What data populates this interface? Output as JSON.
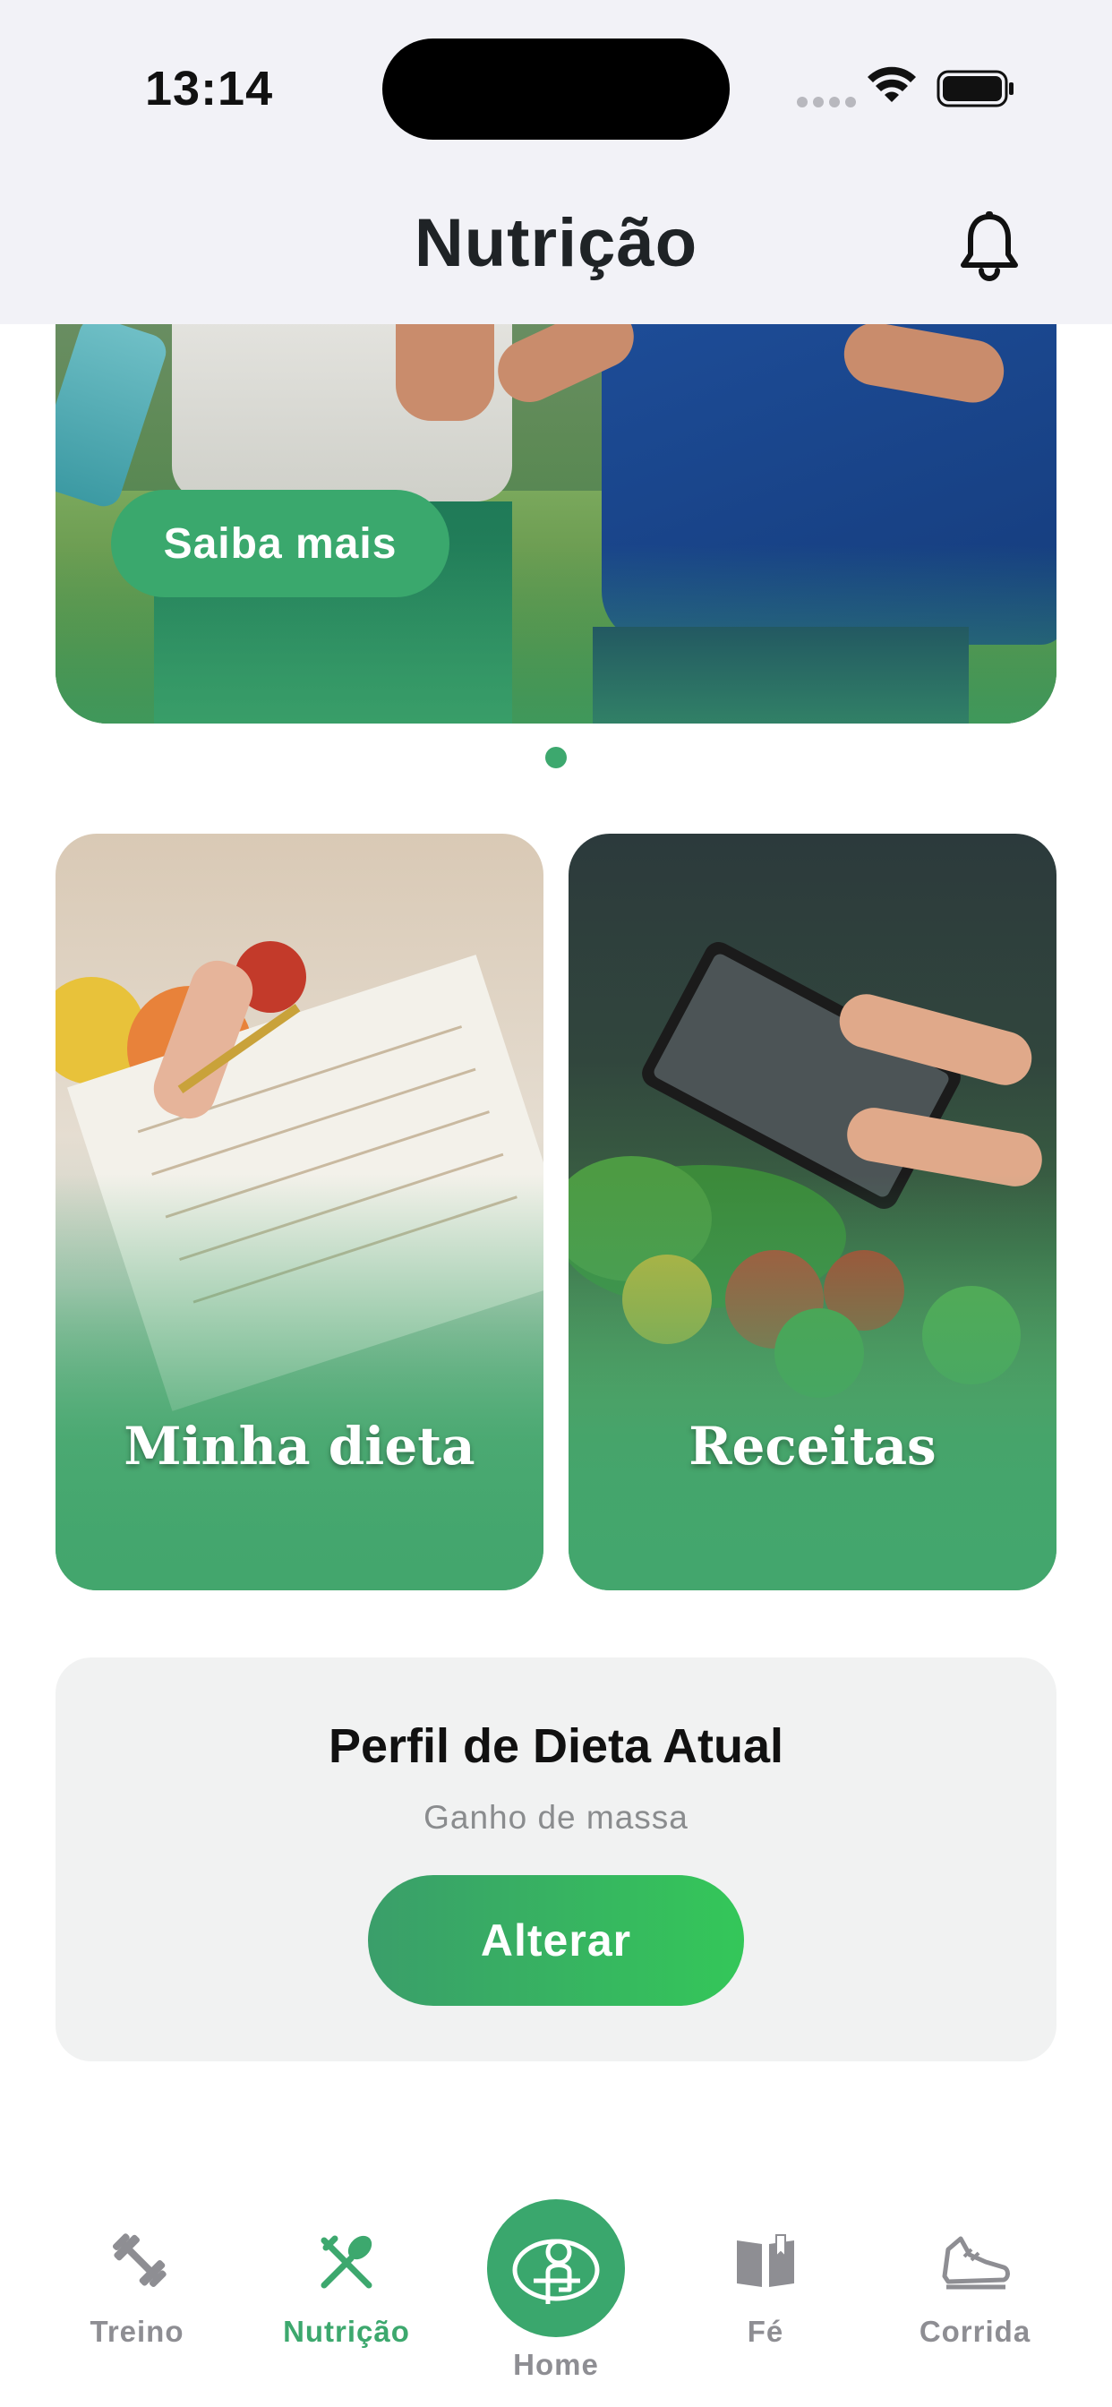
{
  "status_bar": {
    "time": "13:14"
  },
  "header": {
    "title": "Nutrição"
  },
  "banner": {
    "cta_label": "Saiba mais",
    "page_indicator": {
      "current": 1,
      "total": 1
    }
  },
  "cards": [
    {
      "label": "Minha dieta"
    },
    {
      "label": "Receitas"
    }
  ],
  "diet_profile": {
    "title": "Perfil de Dieta Atual",
    "value": "Ganho de massa",
    "button_label": "Alterar"
  },
  "tab_bar": {
    "active": "Nutrição",
    "items": [
      {
        "label": "Treino",
        "icon": "dumbbell-icon"
      },
      {
        "label": "Nutrição",
        "icon": "utensils-icon"
      },
      {
        "label": "Home",
        "icon": "home-logo-icon"
      },
      {
        "label": "Fé",
        "icon": "book-icon"
      },
      {
        "label": "Corrida",
        "icon": "sneaker-icon"
      }
    ]
  },
  "colors": {
    "accent": "#3DA86E",
    "inactive": "#8E8E93",
    "header_bg": "#F2F2F7"
  }
}
